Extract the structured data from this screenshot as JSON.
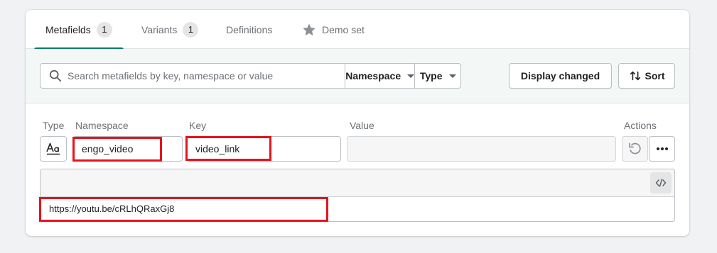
{
  "tabs": [
    {
      "label": "Metafields",
      "count": "1",
      "active": true
    },
    {
      "label": "Variants",
      "count": "1",
      "active": false
    },
    {
      "label": "Definitions",
      "active": false
    },
    {
      "label": "Demo set",
      "icon": "star-icon",
      "active": false
    }
  ],
  "filter": {
    "search_placeholder": "Search metafields by key, namespace or value",
    "search_value": "",
    "namespace_label": "Namespace",
    "type_label": "Type",
    "display_changed_label": "Display changed",
    "sort_label": "Sort"
  },
  "columns": {
    "type": "Type",
    "namespace": "Namespace",
    "key": "Key",
    "value": "Value",
    "actions": "Actions"
  },
  "metafield": {
    "type_icon": "text-type-icon",
    "namespace": "engo_video",
    "key": "video_link",
    "value": "",
    "content": "https://youtu.be/cRLhQRaxGj8"
  },
  "colors": {
    "accent": "#008060",
    "filter_bg": "#f3f8f6",
    "highlight": "#e8121b"
  }
}
